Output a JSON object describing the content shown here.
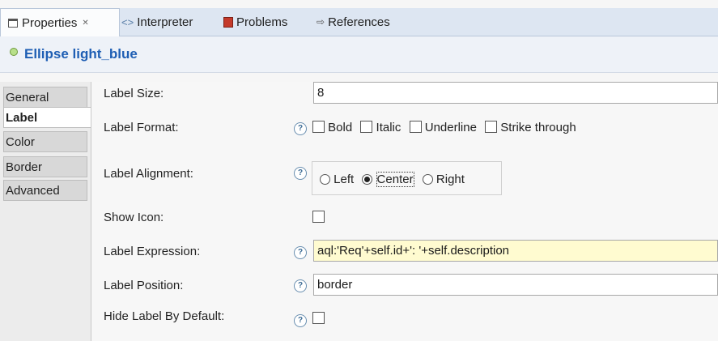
{
  "tabs": [
    {
      "label": "Properties",
      "icon": "properties-icon",
      "active": true
    },
    {
      "label": "Interpreter",
      "icon": "interpreter-icon"
    },
    {
      "label": "Problems",
      "icon": "problems-icon"
    },
    {
      "label": "References",
      "icon": "references-icon"
    }
  ],
  "close_glyph": "✕",
  "title": "Ellipse light_blue",
  "sidebar": {
    "items": [
      "General",
      "Label",
      "Color",
      "Border",
      "Advanced"
    ],
    "selected": "Label"
  },
  "fields": {
    "label_size": {
      "label": "Label Size:",
      "value": "8"
    },
    "label_format": {
      "label": "Label Format:",
      "options": [
        "Bold",
        "Italic",
        "Underline",
        "Strike through"
      ]
    },
    "label_alignment": {
      "label": "Label Alignment:",
      "options": [
        "Left",
        "Center",
        "Right"
      ],
      "selected": "Center"
    },
    "show_icon": {
      "label": "Show Icon:"
    },
    "label_expression": {
      "label": "Label Expression:",
      "value": "aql:'Req'+self.id+': '+self.description"
    },
    "label_position": {
      "label": "Label Position:",
      "value": "border"
    },
    "hide_label": {
      "label": "Hide Label By Default:"
    }
  },
  "colors": {
    "accent": "#1f5fb4",
    "expression_bg": "#fffbd0",
    "tab_bg": "#dde6f2"
  }
}
